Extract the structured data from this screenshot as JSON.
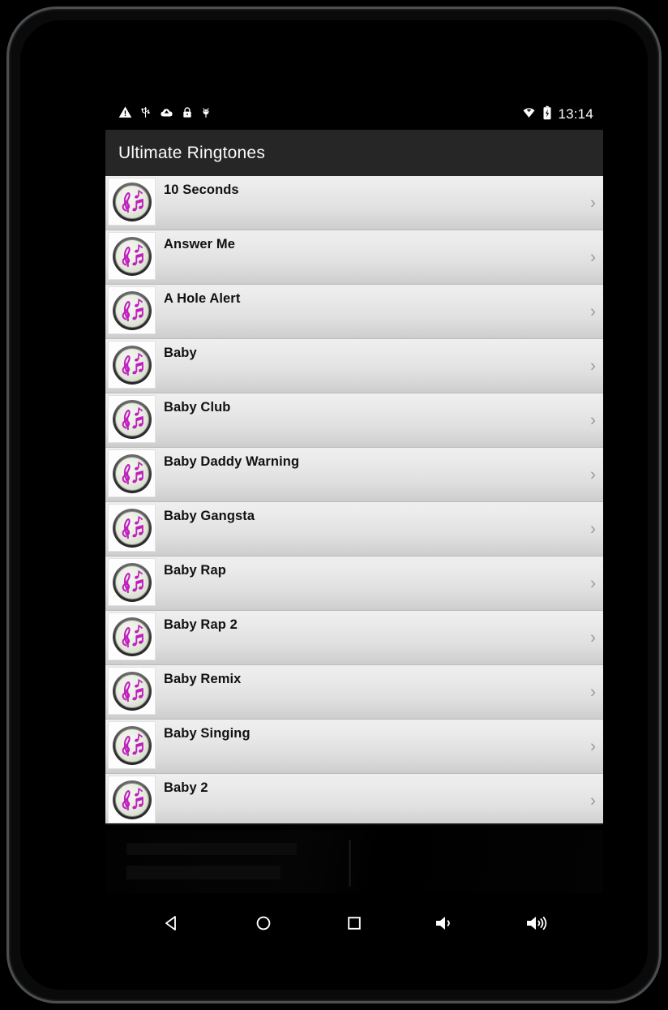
{
  "device": {
    "frame_color": "#4c4f52",
    "body_color": "#0a0a0a"
  },
  "status_bar": {
    "time": "13:14",
    "left_icons": [
      {
        "name": "warning-icon",
        "glyph": "warning"
      },
      {
        "name": "usb-icon",
        "glyph": "usb"
      },
      {
        "name": "cloud-upload-icon",
        "glyph": "cloud"
      },
      {
        "name": "lock-icon",
        "glyph": "lock"
      },
      {
        "name": "bug-icon",
        "glyph": "bug"
      }
    ],
    "right_icons": [
      {
        "name": "wifi-icon",
        "glyph": "wifi"
      },
      {
        "name": "battery-charging-icon",
        "glyph": "battery"
      }
    ],
    "background": "#000000",
    "foreground": "#ffffff"
  },
  "app_bar": {
    "title": "Ultimate Ringtones",
    "background": "#262626",
    "title_color": "#fafafa"
  },
  "list": {
    "row_gradient_top": "#efefef",
    "row_gradient_bottom": "#cacaca",
    "separator_color": "#bdbdbd",
    "label_color": "#111111",
    "chevron_color": "#9c9c9c",
    "chevron_glyph": "›",
    "icon_name": "music-note-badge-icon",
    "icon_accent": "#c020c0",
    "icon_ring": "#4a4a4a",
    "items": [
      {
        "label": "10 Seconds"
      },
      {
        "label": "Answer Me"
      },
      {
        "label": "A Hole Alert"
      },
      {
        "label": "Baby"
      },
      {
        "label": "Baby Club"
      },
      {
        "label": "Baby Daddy Warning"
      },
      {
        "label": "Baby Gangsta"
      },
      {
        "label": "Baby Rap"
      },
      {
        "label": "Baby Rap 2"
      },
      {
        "label": "Baby Remix"
      },
      {
        "label": "Baby Singing"
      },
      {
        "label": "Baby 2"
      }
    ]
  },
  "ad_banner": {
    "name": "advertisement-banner",
    "background": "#000000"
  },
  "nav_bar": {
    "background": "#000000",
    "buttons": [
      {
        "name": "nav-back-button",
        "glyph": "back"
      },
      {
        "name": "nav-home-button",
        "glyph": "home"
      },
      {
        "name": "nav-recents-button",
        "glyph": "recents"
      },
      {
        "name": "nav-volume-down-button",
        "glyph": "volume-down"
      },
      {
        "name": "nav-volume-up-button",
        "glyph": "volume-up"
      }
    ]
  }
}
